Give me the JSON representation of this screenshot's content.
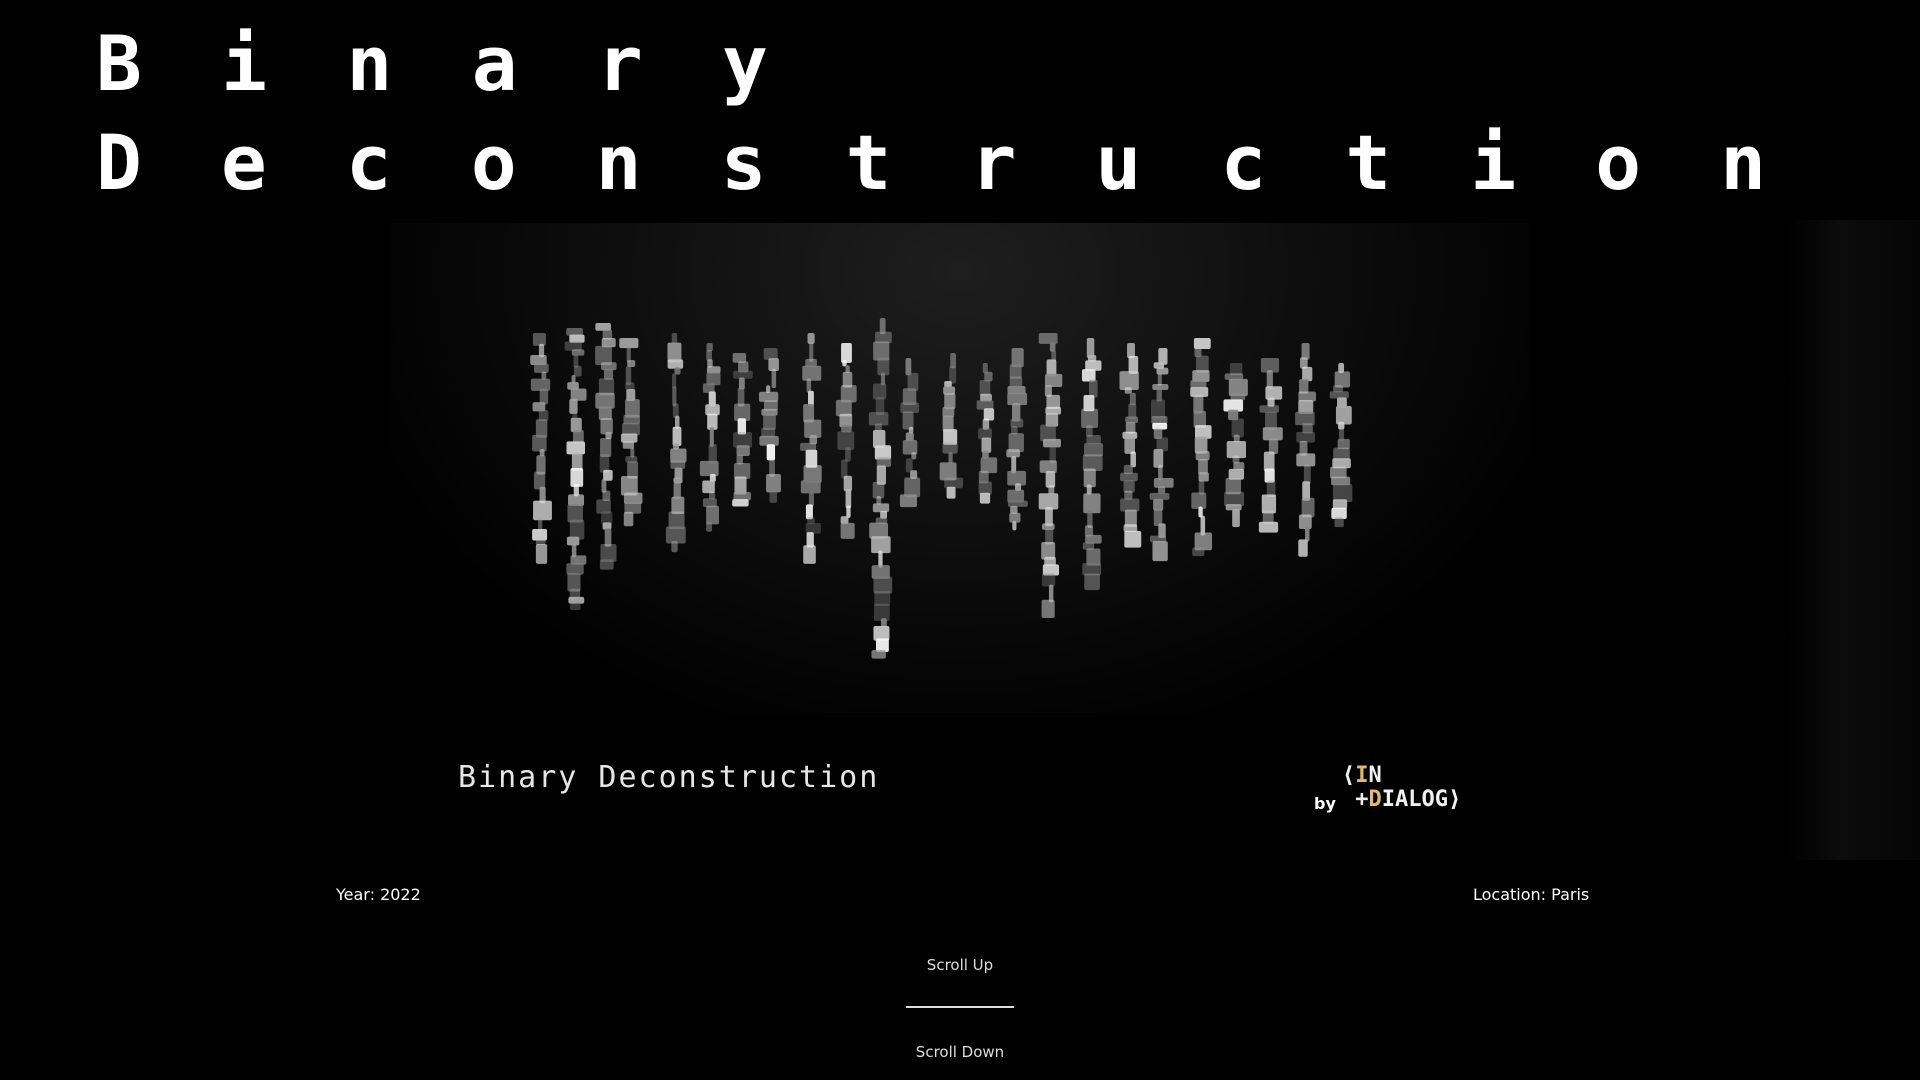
{
  "title": {
    "line1": [
      "B",
      "i",
      "n",
      "a",
      "r",
      "y"
    ],
    "line2": [
      "D",
      "e",
      "c",
      "o",
      "n",
      "s",
      "t",
      "r",
      "u",
      "c",
      "t",
      "i",
      "o",
      "n"
    ]
  },
  "hero": {
    "image_icon": "sculpture-installation-image"
  },
  "caption": "Binary Deconstruction",
  "credit": {
    "by": "by",
    "brand_row1_symbol": "⟨",
    "brand_row1_accent": "I",
    "brand_row1_text": "N",
    "brand_row2_symbol": "+",
    "brand_row2_accent": "D",
    "brand_row2_text": "IALOG⟩",
    "accent_color": "#e0b96a"
  },
  "meta": {
    "year": "Year: 2022",
    "location": "Location: Paris"
  },
  "nav": {
    "scroll_up": "Scroll Up",
    "scroll_down": "Scroll Down"
  }
}
